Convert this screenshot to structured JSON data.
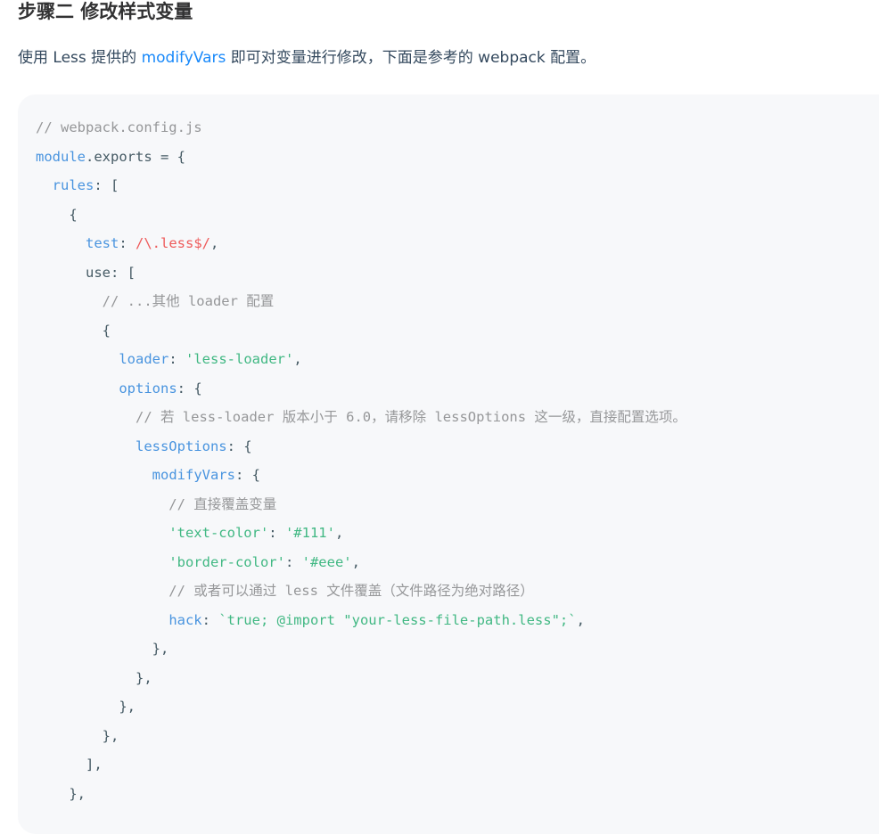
{
  "section": {
    "heading": "步骤二 修改样式变量",
    "intro_before": "使用 Less 提供的 ",
    "intro_link": "modifyVars",
    "intro_after": " 即可对变量进行修改，下面是参考的 webpack 配置。"
  },
  "code": {
    "language": "javascript",
    "lines": [
      [
        {
          "t": "c",
          "v": "// webpack.config.js"
        }
      ],
      [
        {
          "t": "k",
          "v": "module"
        },
        {
          "t": "p",
          "v": "."
        },
        {
          "t": "x",
          "v": "exports = {"
        }
      ],
      [
        {
          "t": "x",
          "v": "  "
        },
        {
          "t": "k",
          "v": "rules"
        },
        {
          "t": "p",
          "v": ": ["
        }
      ],
      [
        {
          "t": "p",
          "v": "    {"
        }
      ],
      [
        {
          "t": "x",
          "v": "      "
        },
        {
          "t": "k",
          "v": "test"
        },
        {
          "t": "p",
          "v": ": "
        },
        {
          "t": "r",
          "v": "/\\.less$/"
        },
        {
          "t": "p",
          "v": ","
        }
      ],
      [
        {
          "t": "x",
          "v": "      use: ["
        }
      ],
      [
        {
          "t": "c",
          "v": "        // ...其他 loader 配置"
        }
      ],
      [
        {
          "t": "p",
          "v": "        {"
        }
      ],
      [
        {
          "t": "x",
          "v": "          "
        },
        {
          "t": "k",
          "v": "loader"
        },
        {
          "t": "p",
          "v": ": "
        },
        {
          "t": "s",
          "v": "'less-loader'"
        },
        {
          "t": "p",
          "v": ","
        }
      ],
      [
        {
          "t": "x",
          "v": "          "
        },
        {
          "t": "k",
          "v": "options"
        },
        {
          "t": "p",
          "v": ": {"
        }
      ],
      [
        {
          "t": "c",
          "v": "            // 若 less-loader 版本小于 6.0，请移除 lessOptions 这一级，直接配置选项。"
        }
      ],
      [
        {
          "t": "x",
          "v": "            "
        },
        {
          "t": "k",
          "v": "lessOptions"
        },
        {
          "t": "p",
          "v": ": {"
        }
      ],
      [
        {
          "t": "x",
          "v": "              "
        },
        {
          "t": "k",
          "v": "modifyVars"
        },
        {
          "t": "p",
          "v": ": {"
        }
      ],
      [
        {
          "t": "c",
          "v": "                // 直接覆盖变量"
        }
      ],
      [
        {
          "t": "x",
          "v": "                "
        },
        {
          "t": "s",
          "v": "'text-color'"
        },
        {
          "t": "p",
          "v": ": "
        },
        {
          "t": "s",
          "v": "'#111'"
        },
        {
          "t": "p",
          "v": ","
        }
      ],
      [
        {
          "t": "x",
          "v": "                "
        },
        {
          "t": "s",
          "v": "'border-color'"
        },
        {
          "t": "p",
          "v": ": "
        },
        {
          "t": "s",
          "v": "'#eee'"
        },
        {
          "t": "p",
          "v": ","
        }
      ],
      [
        {
          "t": "c",
          "v": "                // 或者可以通过 less 文件覆盖（文件路径为绝对路径）"
        }
      ],
      [
        {
          "t": "x",
          "v": "                "
        },
        {
          "t": "k",
          "v": "hack"
        },
        {
          "t": "p",
          "v": ": "
        },
        {
          "t": "s",
          "v": "`true; @import \"your-less-file-path.less\";`"
        },
        {
          "t": "p",
          "v": ","
        }
      ],
      [
        {
          "t": "p",
          "v": "              },"
        }
      ],
      [
        {
          "t": "p",
          "v": "            },"
        }
      ],
      [
        {
          "t": "p",
          "v": "          },"
        }
      ],
      [
        {
          "t": "p",
          "v": "        },"
        }
      ],
      [
        {
          "t": "p",
          "v": "      ],"
        }
      ],
      [
        {
          "t": "p",
          "v": "    },"
        }
      ]
    ]
  },
  "colors": {
    "link": "#1989fa",
    "code_background": "#f7f8fa",
    "comment": "#969799",
    "property": "#4994df",
    "string": "#41b883",
    "regex": "#ee5a5a"
  }
}
